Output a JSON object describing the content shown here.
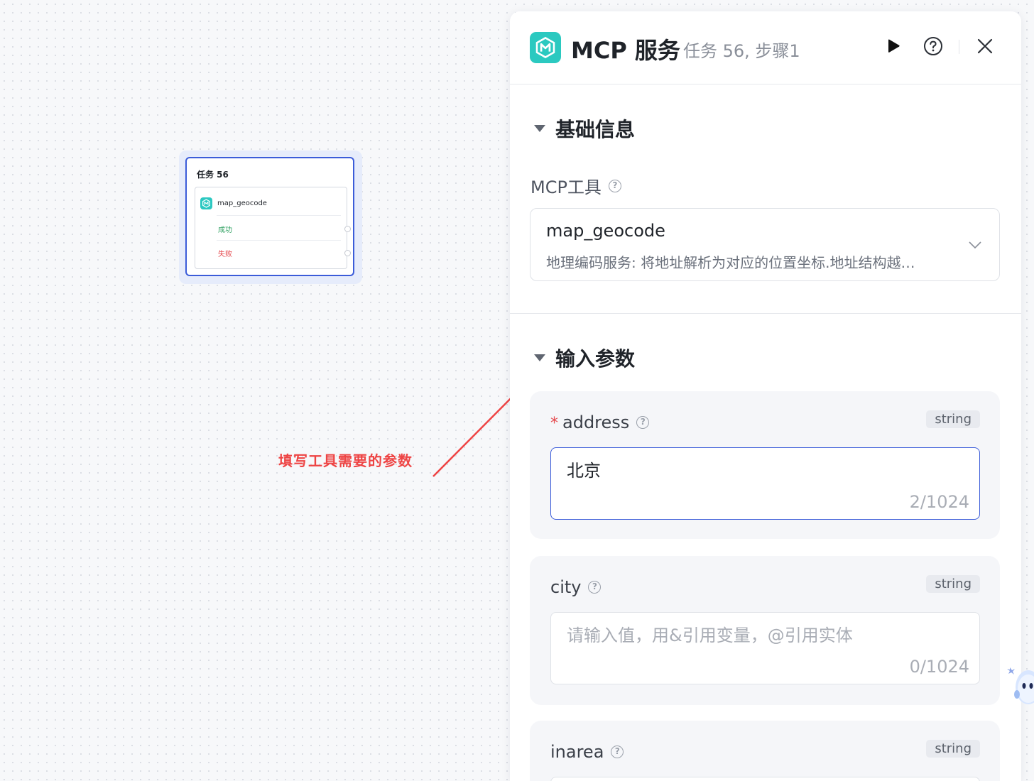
{
  "canvas": {
    "node": {
      "title": "任务 56",
      "tool_name": "map_geocode",
      "success_label": "成功",
      "fail_label": "失败"
    },
    "annotation": "填写工具需要的参数"
  },
  "panel": {
    "title": "MCP 服务",
    "subtitle": "任务 56, 步骤1",
    "icons": {
      "run": "play-icon",
      "help": "help-circle-icon",
      "close": "close-icon"
    },
    "basic": {
      "section_title": "基础信息",
      "tool_label": "MCP工具",
      "tool_value": "map_geocode",
      "tool_desc": "地理编码服务: 将地址解析为对应的位置坐标.地址结构越…"
    },
    "inputs": {
      "section_title": "输入参数",
      "params": [
        {
          "name": "address",
          "required_mark": "*",
          "type": "string",
          "value": "北京",
          "placeholder": "",
          "counter": "2/1024"
        },
        {
          "name": "city",
          "type": "string",
          "value": "",
          "placeholder": "请输入值，用&引用变量，@引用实体",
          "counter": "0/1024"
        },
        {
          "name": "inarea",
          "type": "string"
        }
      ]
    }
  },
  "colors": {
    "accent": "#3b5cd9",
    "brand_teal": "#2bc9c0",
    "annotation_red": "#ee4444",
    "success": "#2ea060",
    "danger": "#e5484d"
  }
}
